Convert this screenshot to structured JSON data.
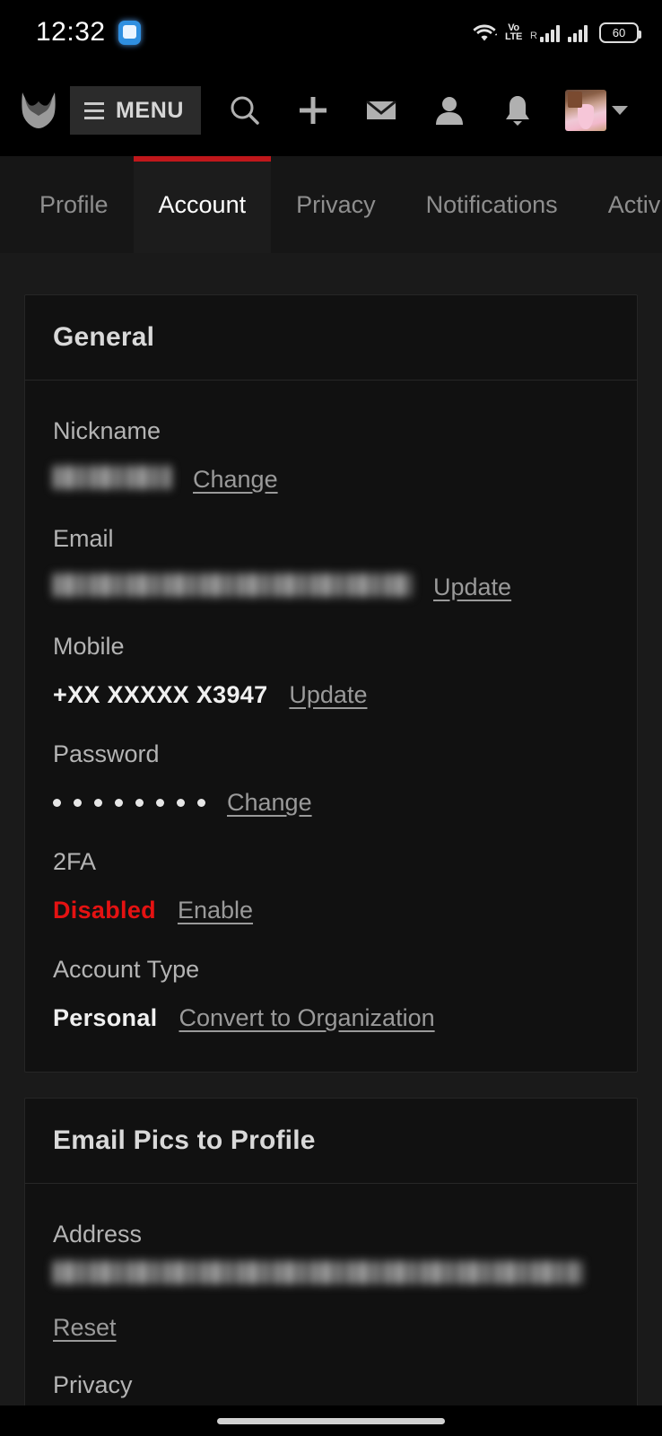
{
  "accent": "#c0171b",
  "statusbar": {
    "clock": "12:32",
    "app_icon": "messaging-app-icon",
    "wifi_icon": "wifi-icon",
    "volte_line1": "Vo",
    "volte_line2": "LTE",
    "roaming_label": "R",
    "signal_icon_1": "signal-bars-icon",
    "signal_icon_2": "signal-bars-icon",
    "battery_level": "60"
  },
  "appbar": {
    "logo_icon": "site-logo-icon",
    "menu_label": "MENU",
    "hamburger_icon": "hamburger-icon",
    "icons": [
      {
        "name": "search-icon"
      },
      {
        "name": "plus-icon"
      },
      {
        "name": "mail-icon"
      },
      {
        "name": "person-icon"
      },
      {
        "name": "bell-icon"
      }
    ],
    "avatar_alt": "user-avatar",
    "caret_icon": "chevron-down-icon"
  },
  "tabs": [
    {
      "label": "Profile",
      "active": false
    },
    {
      "label": "Account",
      "active": true
    },
    {
      "label": "Privacy",
      "active": false
    },
    {
      "label": "Notifications",
      "active": false
    },
    {
      "label": "Activi",
      "active": false
    }
  ],
  "cards": [
    {
      "title": "General",
      "fields": [
        {
          "label": "Nickname",
          "value_type": "blurred",
          "blur_class": "w-nick",
          "action": "Change"
        },
        {
          "label": "Email",
          "value_type": "blurred",
          "blur_class": "w-email",
          "action": "Update"
        },
        {
          "label": "Mobile",
          "value_type": "text",
          "value": "+XX XXXXX X3947",
          "action": "Update"
        },
        {
          "label": "Password",
          "value_type": "dots",
          "dots_count": 8,
          "action": "Change"
        },
        {
          "label": "2FA",
          "value_type": "text",
          "value": "Disabled",
          "value_color": "red",
          "action": "Enable"
        },
        {
          "label": "Account Type",
          "value_type": "text",
          "value": "Personal",
          "action": "Convert to Organization"
        }
      ]
    },
    {
      "title": "Email Pics to Profile",
      "fields": [
        {
          "label": "Address",
          "value_type": "blurred",
          "blur_class": "w-addr",
          "action_below": "Reset"
        },
        {
          "label": "Privacy",
          "value_type": "none"
        }
      ]
    }
  ]
}
